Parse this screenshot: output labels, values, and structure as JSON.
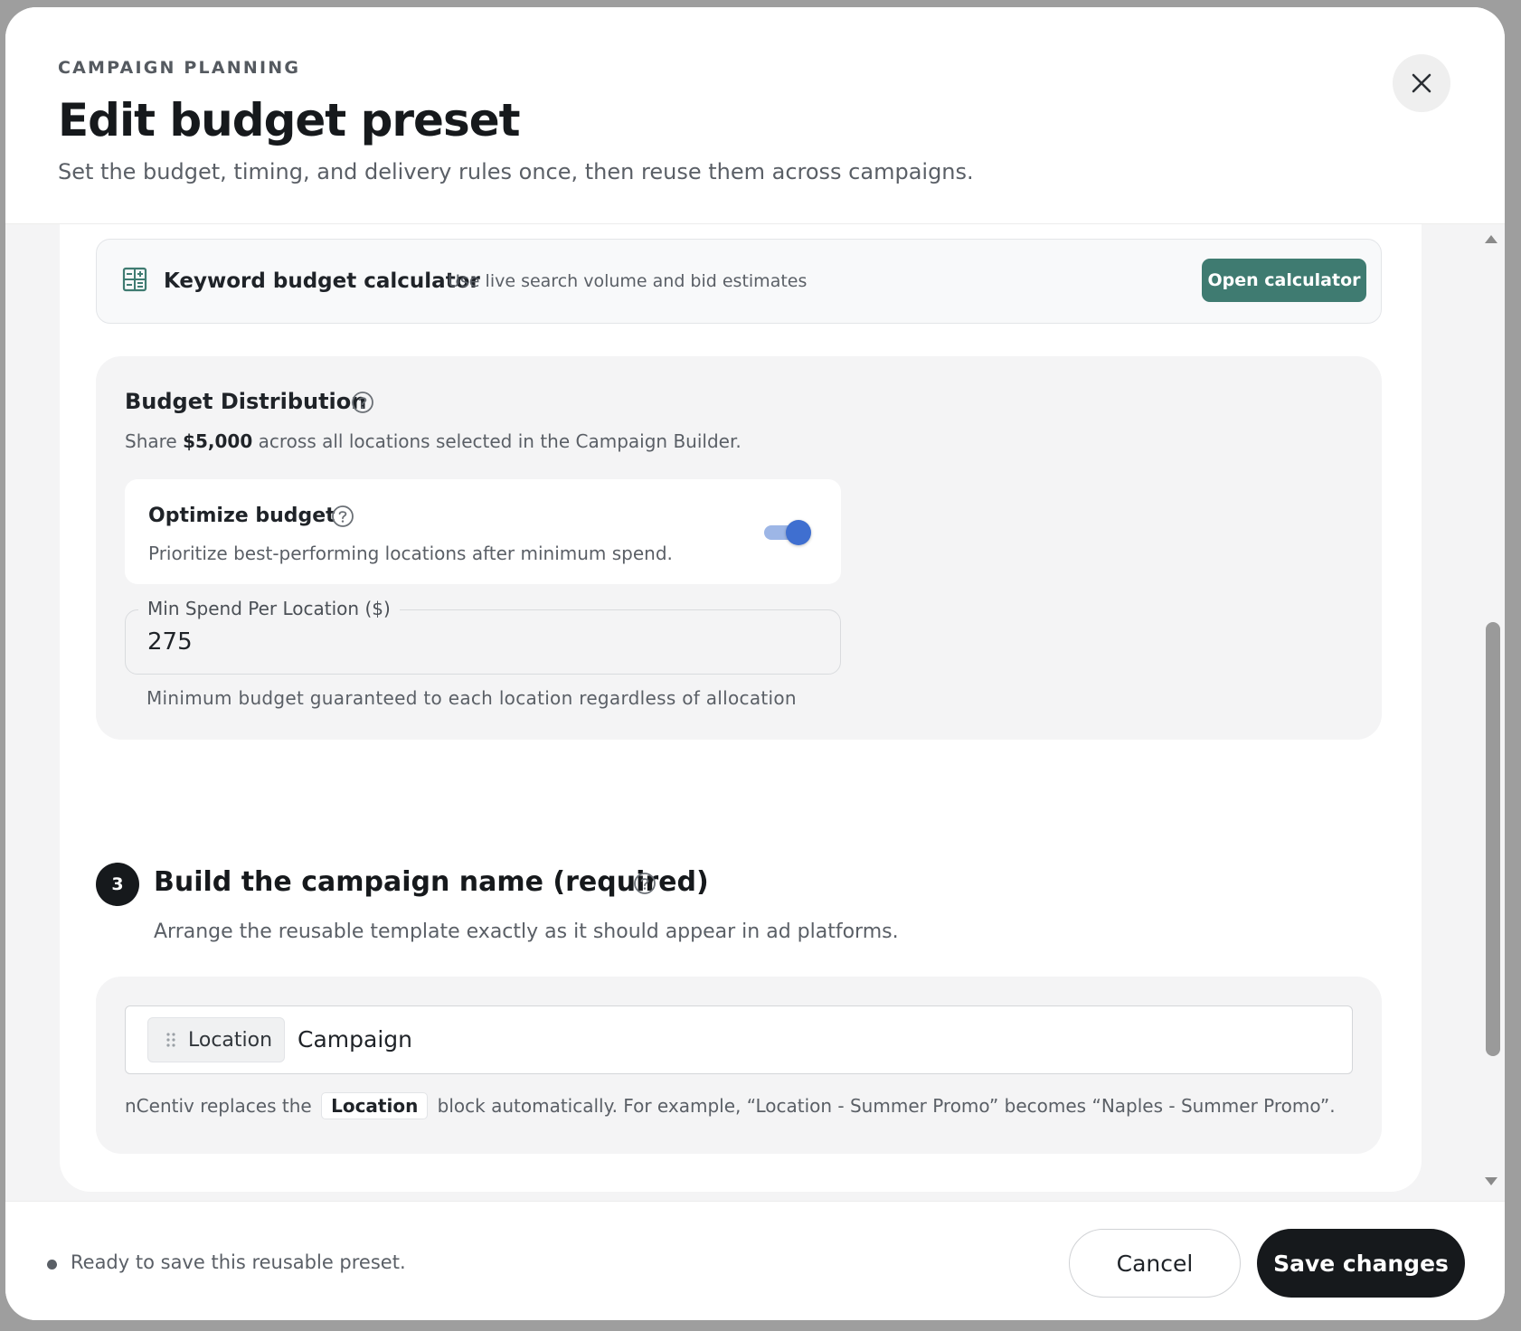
{
  "header": {
    "eyebrow": "CAMPAIGN PLANNING",
    "title": "Edit budget preset",
    "subtitle": "Set the budget, timing, and delivery rules once, then reuse them across campaigns.",
    "close_icon": "close-icon"
  },
  "calculator": {
    "icon": "calculator-icon",
    "title": "Keyword budget calculator",
    "subtitle": "Use live search volume and bid estimates",
    "button_label": "Open calculator",
    "button_color": "#3f7b71"
  },
  "distribution": {
    "title": "Budget Distribution",
    "desc_prefix": "Share ",
    "desc_amount": "$5,000",
    "desc_suffix": " across all locations selected in the Campaign Builder.",
    "optimize": {
      "title": "Optimize budget",
      "desc": "Prioritize best-performing locations after minimum spend.",
      "enabled": true,
      "toggle_color": "#3f6fd0"
    },
    "min_spend": {
      "label": "Min Spend Per Location ($)",
      "value": "275",
      "help": "Minimum budget guaranteed to each location regardless of allocation"
    }
  },
  "step3": {
    "number": "3",
    "title": "Build the campaign name (required)",
    "desc": "Arrange the reusable template exactly as it should appear in ad platforms.",
    "chip_label": "Location",
    "name_text": "Campaign",
    "help_prefix": "nCentiv replaces the",
    "help_chip": "Location",
    "help_suffix": "block automatically. For example,  “Location - Summer Promo” becomes “Naples - Summer Promo”."
  },
  "footer": {
    "status": "Ready to save this reusable preset.",
    "cancel_label": "Cancel",
    "save_label": "Save changes"
  }
}
